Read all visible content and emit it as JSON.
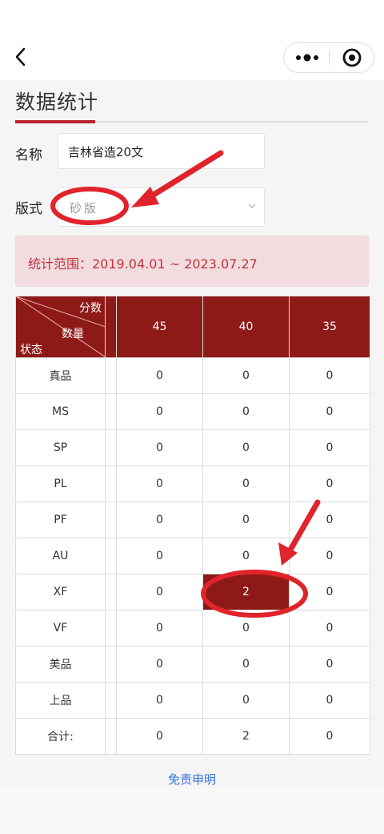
{
  "page": {
    "title": "数据统计"
  },
  "form": {
    "name_label": "名称",
    "name_value": "吉林省造20文",
    "edition_label": "版式",
    "edition_placeholder": "砂版"
  },
  "range": {
    "text": "统计范围：2019.04.01 ~ 2023.07.27"
  },
  "table": {
    "header": {
      "score_label": "分数",
      "count_label": "数量",
      "status_label": "状态"
    },
    "columns": [
      "45",
      "40",
      "35"
    ],
    "rows": [
      {
        "label": "真品",
        "values": [
          "0",
          "0",
          "0"
        ]
      },
      {
        "label": "MS",
        "values": [
          "0",
          "0",
          "0"
        ]
      },
      {
        "label": "SP",
        "values": [
          "0",
          "0",
          "0"
        ]
      },
      {
        "label": "PL",
        "values": [
          "0",
          "0",
          "0"
        ]
      },
      {
        "label": "PF",
        "values": [
          "0",
          "0",
          "0"
        ]
      },
      {
        "label": "AU",
        "values": [
          "0",
          "0",
          "0"
        ]
      },
      {
        "label": "XF",
        "values": [
          "0",
          "2",
          "0"
        ]
      },
      {
        "label": "VF",
        "values": [
          "0",
          "0",
          "0"
        ]
      },
      {
        "label": "美品",
        "values": [
          "0",
          "0",
          "0"
        ]
      },
      {
        "label": "上品",
        "values": [
          "0",
          "0",
          "0"
        ]
      },
      {
        "label": "合计:",
        "values": [
          "0",
          "2",
          "0"
        ]
      }
    ]
  },
  "footer": {
    "disclaimer": "免责申明"
  },
  "colors": {
    "accent": "#8e1a17",
    "range_bg": "#f2dcdf",
    "range_text": "#c0323a",
    "link": "#3a74d6",
    "annotation": "#e0242b"
  },
  "icons": {
    "back": "chevron-left-icon",
    "more": "more-dots-icon",
    "target": "target-icon",
    "dropdown": "chevron-down-icon"
  }
}
